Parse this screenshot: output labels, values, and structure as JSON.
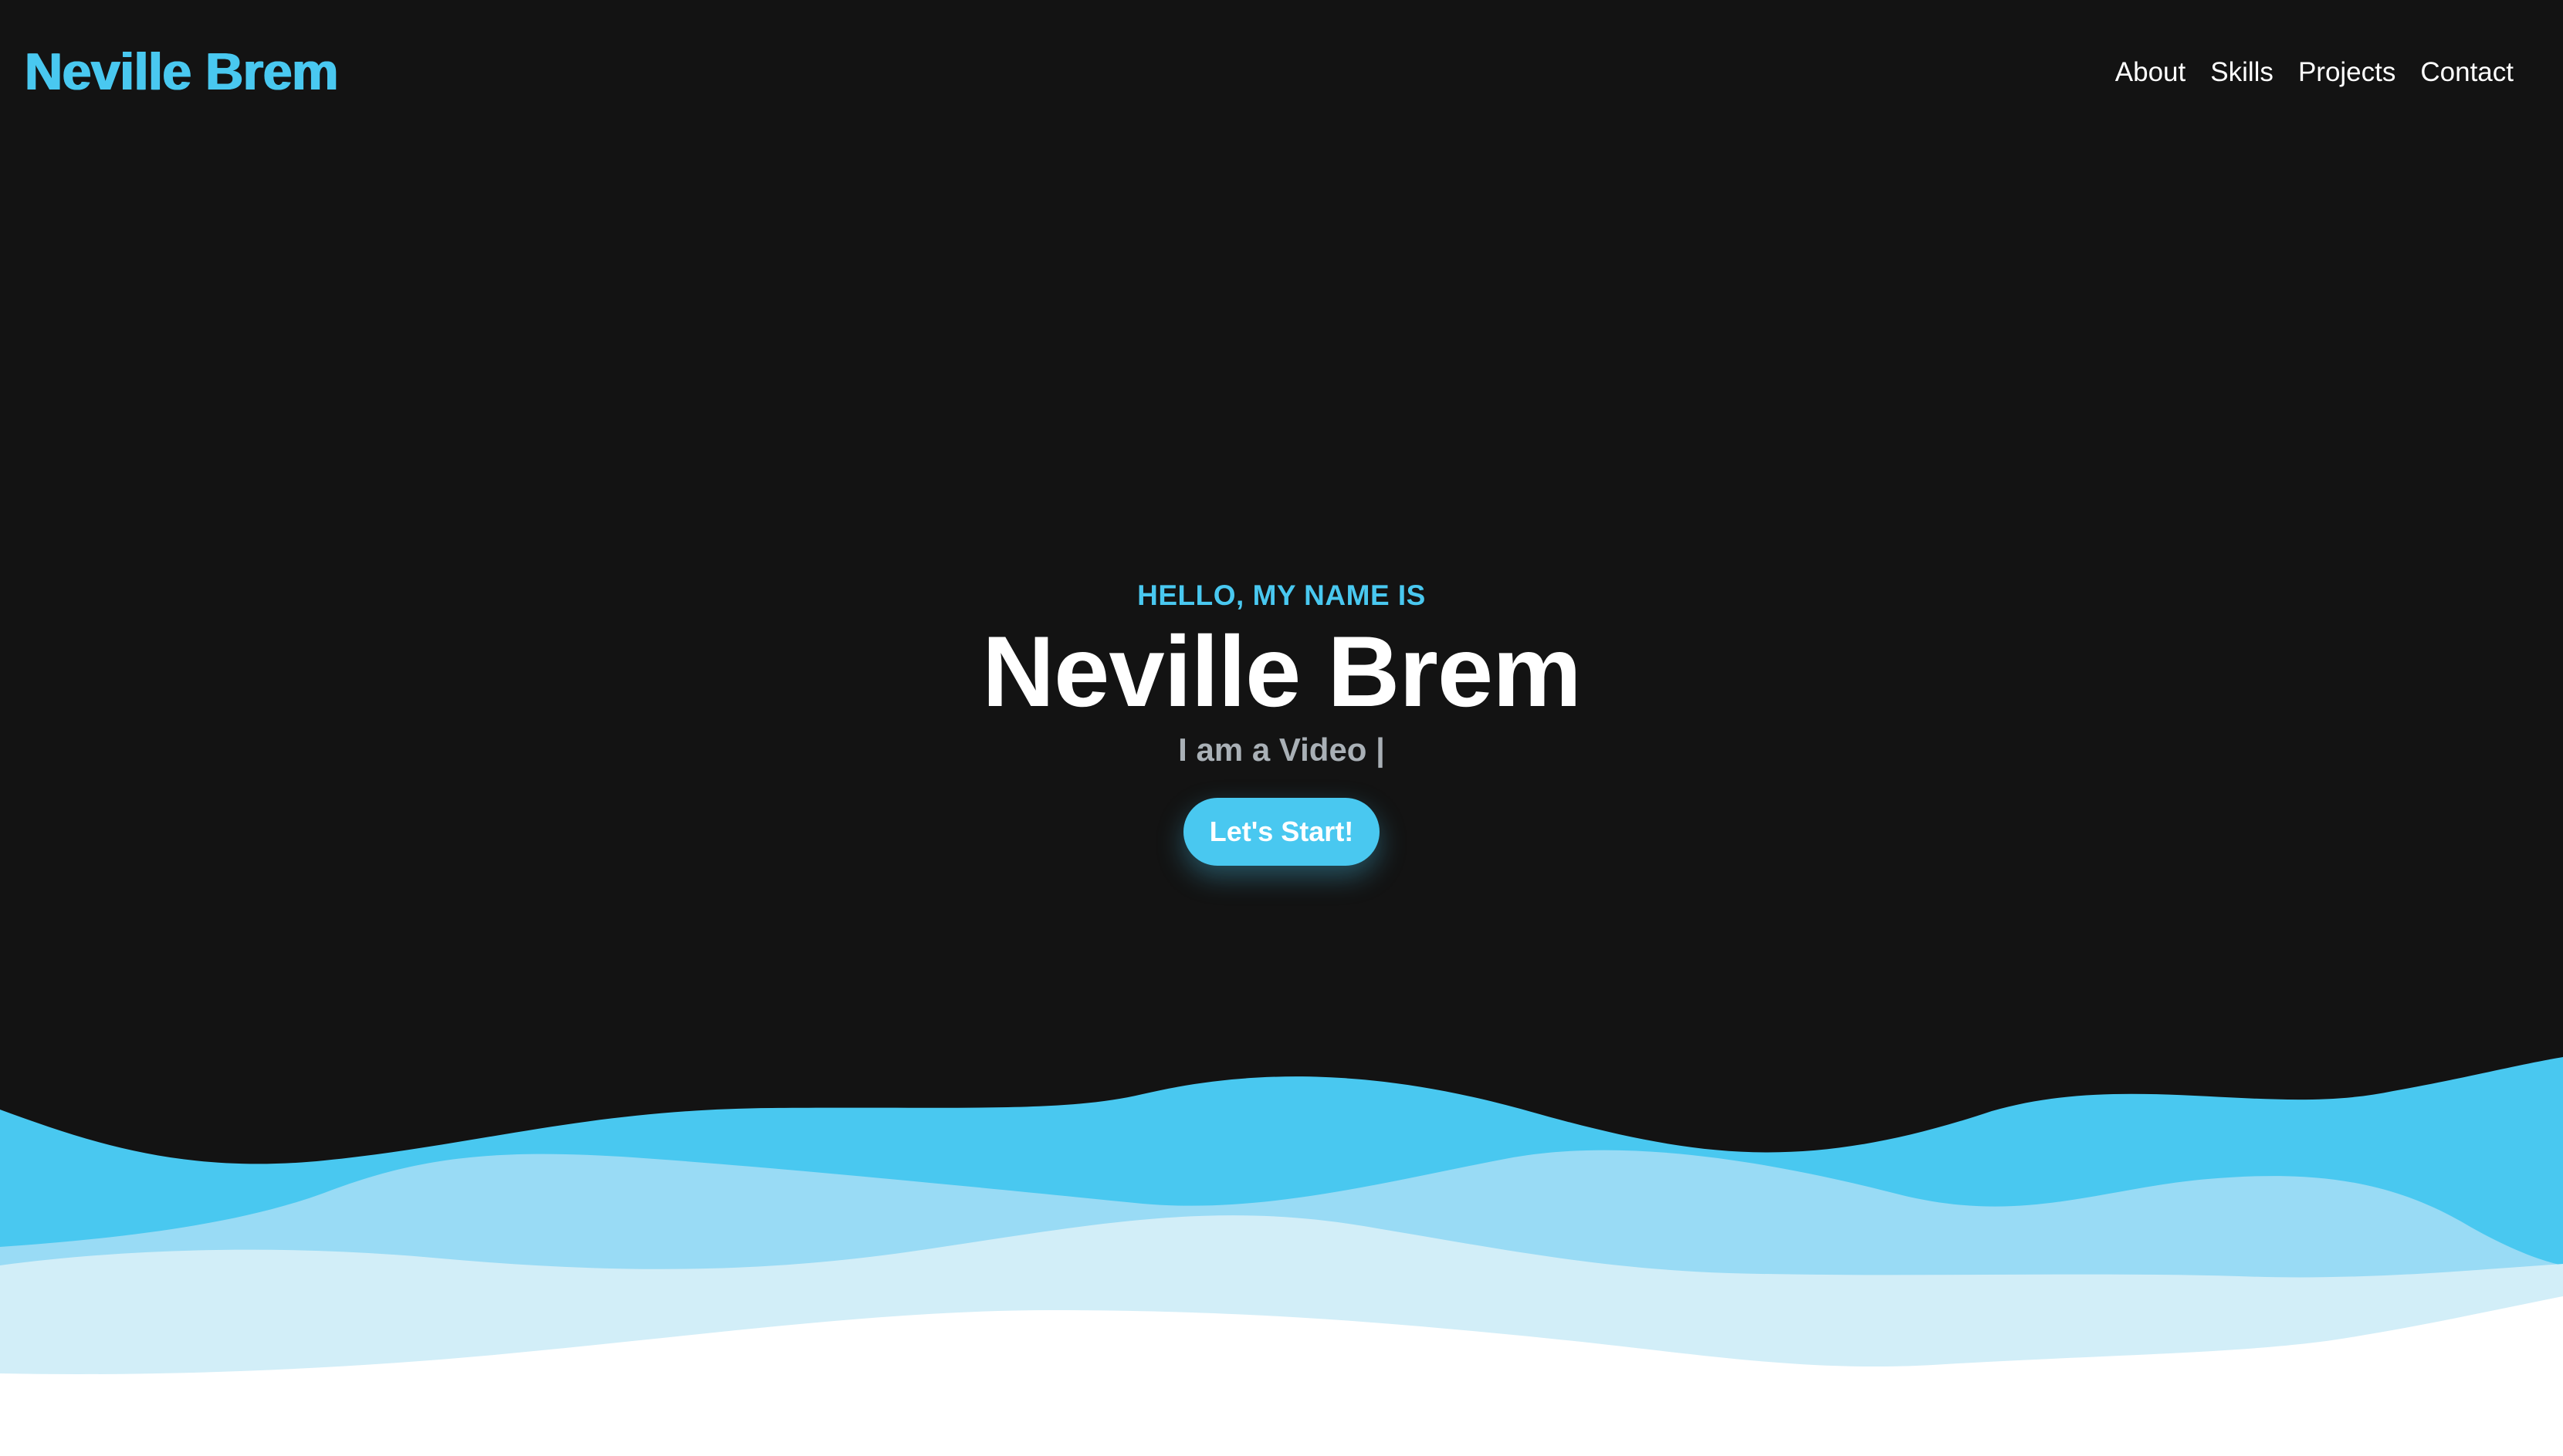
{
  "nav": {
    "brand": "Neville Brem",
    "links": [
      "About",
      "Skills",
      "Projects",
      "Contact"
    ]
  },
  "hero": {
    "eyebrow": "HELLO, MY NAME IS",
    "name": "Neville Brem",
    "tagline": "I am a Video |",
    "cta_label": "Let's Start!"
  },
  "colors": {
    "background": "#131313",
    "accent": "#49c8f0",
    "wave_mid": "#99dbf5",
    "wave_light": "#d2eef8",
    "text_primary": "#ffffff",
    "text_muted": "#a9b0b6"
  }
}
